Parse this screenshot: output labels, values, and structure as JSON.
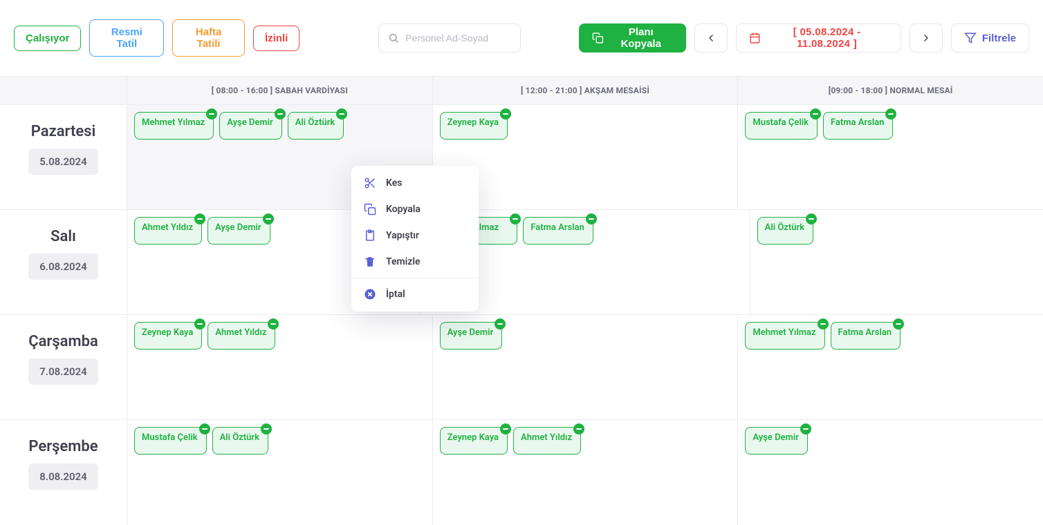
{
  "toolbar": {
    "status": {
      "working": "Çalışıyor",
      "holiday": "Resmi Tatil",
      "weekend": "Hafta Tatili",
      "leave": "İzinli"
    },
    "search_placeholder": "Personel Ad-Soyad",
    "copy_plan": "Planı Kopyala",
    "date_range": "[ 05.08.2024 - 11.08.2024 ]",
    "filter": "Filtrele"
  },
  "shifts": [
    "[ 08:00 - 16:00 ] SABAH VARDİYASI",
    "[ 12:00 - 21:00 ] AKŞAM MESAİSİ",
    "[09:00 - 18:00 ] NORMAL MESAİ"
  ],
  "days": [
    {
      "name": "Pazartesi",
      "date": "5.08.2024",
      "selected_shift": 0,
      "cells": [
        [
          "Mehmet Yılmaz",
          "Ayşe Demir",
          "Ali Öztürk"
        ],
        [
          "Zeynep Kaya"
        ],
        [
          "Mustafa Çelik",
          "Fatma Arslan"
        ]
      ]
    },
    {
      "name": "Salı",
      "date": "6.08.2024",
      "selected_shift": -1,
      "cells": [
        [
          "Ahmet Yıldız",
          "Ayşe Demir"
        ],
        [
          "Mehmet Yılmaz",
          "Fatma Arslan"
        ],
        [
          "Ali Öztürk"
        ]
      ]
    },
    {
      "name": "Çarşamba",
      "date": "7.08.2024",
      "selected_shift": -1,
      "cells": [
        [
          "Zeynep Kaya",
          "Ahmet Yıldız"
        ],
        [
          "Ayşe Demir"
        ],
        [
          "Mehmet Yılmaz",
          "Fatma Arslan"
        ]
      ]
    },
    {
      "name": "Perşembe",
      "date": "8.08.2024",
      "selected_shift": -1,
      "cells": [
        [
          "Mustafa Çelik",
          "Ali Öztürk"
        ],
        [
          "Zeynep Kaya",
          "Ahmet Yıldız"
        ],
        [
          "Ayşe Demir"
        ]
      ]
    }
  ],
  "context_menu": {
    "cut": "Kes",
    "copy": "Kopyala",
    "paste": "Yapıştır",
    "clear": "Temizle",
    "cancel": "İptal"
  },
  "r1_c1_chip2_partial": "Yılmaz"
}
